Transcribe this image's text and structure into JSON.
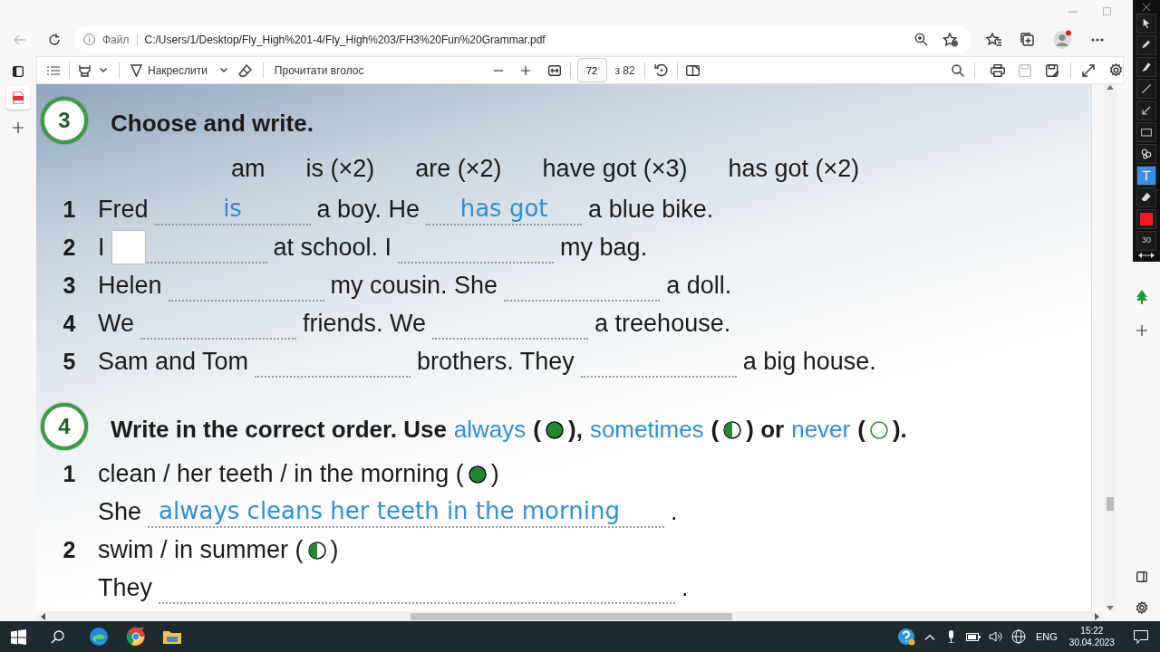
{
  "address_bar": {
    "scheme_label": "Файл",
    "url": "C:/Users/1/Desktop/Fly_High%201-4/Fly_High%203/FH3%20Fun%20Grammar.pdf"
  },
  "pdf_toolbar": {
    "draw_label": "Накреслити",
    "read_aloud_label": "Прочитати вголос",
    "page": "72",
    "page_total": "з 82",
    "save_disabled": true
  },
  "exercises": [
    {
      "number": "3",
      "title": [
        {
          "kind": "text",
          "text": "Choose and write."
        }
      ],
      "word_bank": [
        "am",
        "is (×2)",
        "are (×2)",
        "have got (×3)",
        "has got (×2)"
      ],
      "items": [
        {
          "number": "1",
          "segments": [
            {
              "kind": "text",
              "text": "Fred"
            },
            {
              "kind": "blank",
              "answer": "is"
            },
            {
              "kind": "text",
              "text": "a boy. He"
            },
            {
              "kind": "blank",
              "answer": "has got"
            },
            {
              "kind": "text",
              "text": "a blue bike."
            }
          ]
        },
        {
          "number": "2",
          "segments": [
            {
              "kind": "text",
              "text": "I"
            },
            {
              "kind": "blank",
              "input_box": true
            },
            {
              "kind": "text",
              "text": "at school. I"
            },
            {
              "kind": "blank"
            },
            {
              "kind": "text",
              "text": "my bag."
            }
          ]
        },
        {
          "number": "3",
          "segments": [
            {
              "kind": "text",
              "text": "Helen"
            },
            {
              "kind": "blank"
            },
            {
              "kind": "text",
              "text": "my cousin. She"
            },
            {
              "kind": "blank"
            },
            {
              "kind": "text",
              "text": "a doll."
            }
          ]
        },
        {
          "number": "4",
          "segments": [
            {
              "kind": "text",
              "text": "We"
            },
            {
              "kind": "blank"
            },
            {
              "kind": "text",
              "text": "friends. We"
            },
            {
              "kind": "blank"
            },
            {
              "kind": "text",
              "text": "a treehouse."
            }
          ]
        },
        {
          "number": "5",
          "segments": [
            {
              "kind": "text",
              "text": "Sam and Tom"
            },
            {
              "kind": "blank"
            },
            {
              "kind": "text",
              "text": "brothers. They"
            },
            {
              "kind": "blank"
            },
            {
              "kind": "text",
              "text": "a big house."
            }
          ]
        }
      ]
    },
    {
      "number": "4",
      "title": [
        {
          "kind": "text",
          "text": "Write in the correct order. Use"
        },
        {
          "kind": "word",
          "text": "always"
        },
        {
          "kind": "text",
          "text": "("
        },
        {
          "kind": "dot_full"
        },
        {
          "kind": "text",
          "text": "),"
        },
        {
          "kind": "word",
          "text": "sometimes"
        },
        {
          "kind": "text",
          "text": "("
        },
        {
          "kind": "dot_half"
        },
        {
          "kind": "text",
          "text": ") or"
        },
        {
          "kind": "word",
          "text": "never"
        },
        {
          "kind": "text",
          "text": "("
        },
        {
          "kind": "dot_empty"
        },
        {
          "kind": "text",
          "text": ")."
        }
      ],
      "items": [
        {
          "number": "1",
          "segments": [
            {
              "kind": "text",
              "text": "clean / her teeth / in the morning ("
            },
            {
              "kind": "dot_full"
            },
            {
              "kind": "text",
              "text": ")"
            }
          ],
          "answer_line": {
            "subject": "She",
            "answer": "always cleans her teeth in the morning",
            "end": "."
          }
        },
        {
          "number": "2",
          "segments": [
            {
              "kind": "text",
              "text": "swim / in summer ("
            },
            {
              "kind": "dot_half"
            },
            {
              "kind": "text",
              "text": ")"
            }
          ],
          "answer_line": {
            "subject": "They",
            "end": "."
          }
        }
      ]
    }
  ],
  "screen_draw_toolbar": {
    "tools": [
      {
        "selected": false
      },
      {
        "selected": false
      },
      {
        "selected": false
      },
      {
        "selected": false
      },
      {
        "selected": false
      },
      {
        "selected": false
      },
      {
        "selected": false
      },
      {
        "selected": true
      },
      {
        "selected": false
      }
    ],
    "color": "#ee1c1c",
    "pen_size": "30"
  },
  "taskbar": {
    "language": "ENG",
    "time": "15:22",
    "date": "30.04.2023"
  }
}
